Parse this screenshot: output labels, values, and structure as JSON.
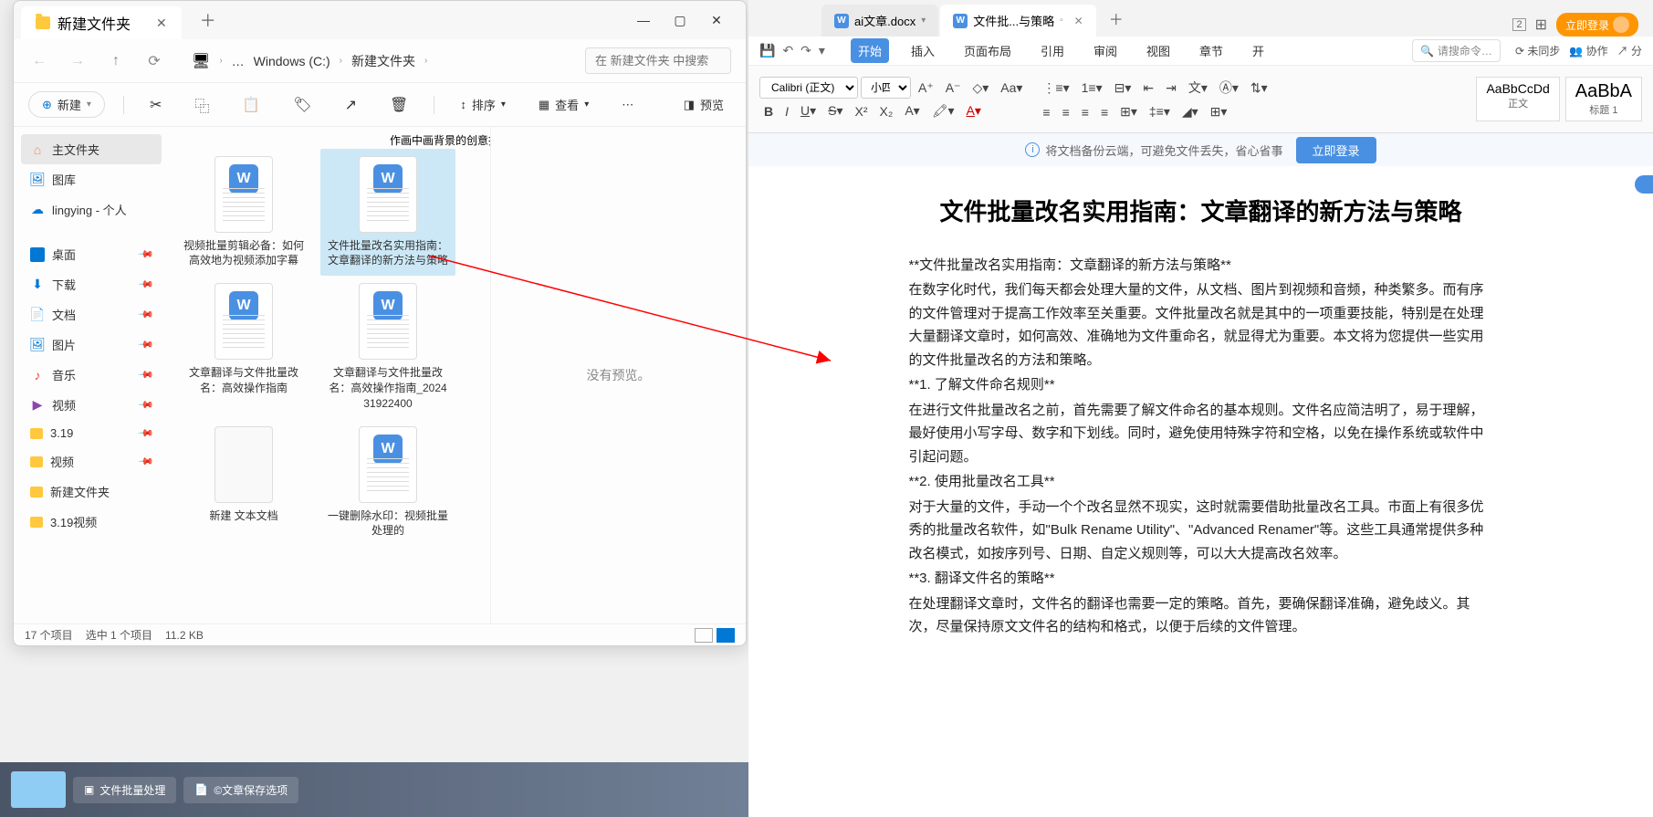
{
  "explorer": {
    "tab_title": "新建文件夹",
    "breadcrumb": {
      "dots": "…",
      "drive": "Windows (C:)",
      "folder": "新建文件夹"
    },
    "search_placeholder": "在 新建文件夹 中搜索",
    "toolbar": {
      "new": "新建",
      "sort": "排序",
      "view": "查看",
      "preview": "预览"
    },
    "sidebar": {
      "home": "主文件夹",
      "gallery": "图库",
      "onedrive": "lingying - 个人",
      "desktop": "桌面",
      "downloads": "下载",
      "documents": "文档",
      "pictures": "图片",
      "music": "音乐",
      "videos": "视频",
      "f319": "3.19",
      "fvideo": "视频",
      "fnew": "新建文件夹",
      "f319v": "3.19视频"
    },
    "files": {
      "f0": "作画中画背景的创意技巧",
      "f1": "视频批量剪辑必备：如何高效地为视频添加字幕",
      "f2": "文件批量改名实用指南：文章翻译的新方法与策略",
      "f3": "文章翻译与文件批量改名：高效操作指南",
      "f4": "文章翻译与文件批量改名：高效操作指南_202431922400",
      "f5": "新建 文本文档",
      "f6": "一键删除水印：视频批量处理的"
    },
    "preview_empty": "没有预览。",
    "status": {
      "items": "17 个项目",
      "selected": "选中 1 个项目",
      "size": "11.2 KB"
    }
  },
  "wps": {
    "tabs": {
      "t1": "ai文章.docx",
      "t2": "文件批...与策略"
    },
    "login": "立即登录",
    "ribbon_tabs": {
      "start": "开始",
      "insert": "插入",
      "layout": "页面布局",
      "reference": "引用",
      "review": "审阅",
      "view": "视图",
      "chapter": "章节",
      "open": "开"
    },
    "search_placeholder": "请搜命令…",
    "sync": "未同步",
    "coop": "协作",
    "share": "分",
    "font": "Calibri (正文)",
    "size": "小四",
    "styles": {
      "normal_preview": "AaBbCcDd",
      "normal": "正文",
      "h1_preview": "AaBbA",
      "h1": "标题 1"
    },
    "banner": {
      "text": "将文档备份云端，可避免文件丢失，省心省事",
      "btn": "立即登录"
    },
    "doc": {
      "title": "文件批量改名实用指南：文章翻译的新方法与策略",
      "p1": "**文件批量改名实用指南：文章翻译的新方法与策略**",
      "p2": "在数字化时代，我们每天都会处理大量的文件，从文档、图片到视频和音频，种类繁多。而有序的文件管理对于提高工作效率至关重要。文件批量改名就是其中的一项重要技能，特别是在处理大量翻译文章时，如何高效、准确地为文件重命名，就显得尤为重要。本文将为您提供一些实用的文件批量改名的方法和策略。",
      "p3": "**1. 了解文件命名规则**",
      "p4": "在进行文件批量改名之前，首先需要了解文件命名的基本规则。文件名应简洁明了，易于理解，最好使用小写字母、数字和下划线。同时，避免使用特殊字符和空格，以免在操作系统或软件中引起问题。",
      "p5": "**2. 使用批量改名工具**",
      "p6": "对于大量的文件，手动一个个改名显然不现实，这时就需要借助批量改名工具。市面上有很多优秀的批量改名软件，如\"Bulk Rename Utility\"、\"Advanced Renamer\"等。这些工具通常提供多种改名模式，如按序列号、日期、自定义规则等，可以大大提高改名效率。",
      "p7": "**3. 翻译文件名的策略**",
      "p8": "在处理翻译文章时，文件名的翻译也需要一定的策略。首先，要确保翻译准确，避免歧义。其次，尽量保持原文文件名的结构和格式，以便于后续的文件管理。"
    }
  },
  "taskbar": {
    "batch": "文件批量处理",
    "save": "©文章保存选项"
  }
}
